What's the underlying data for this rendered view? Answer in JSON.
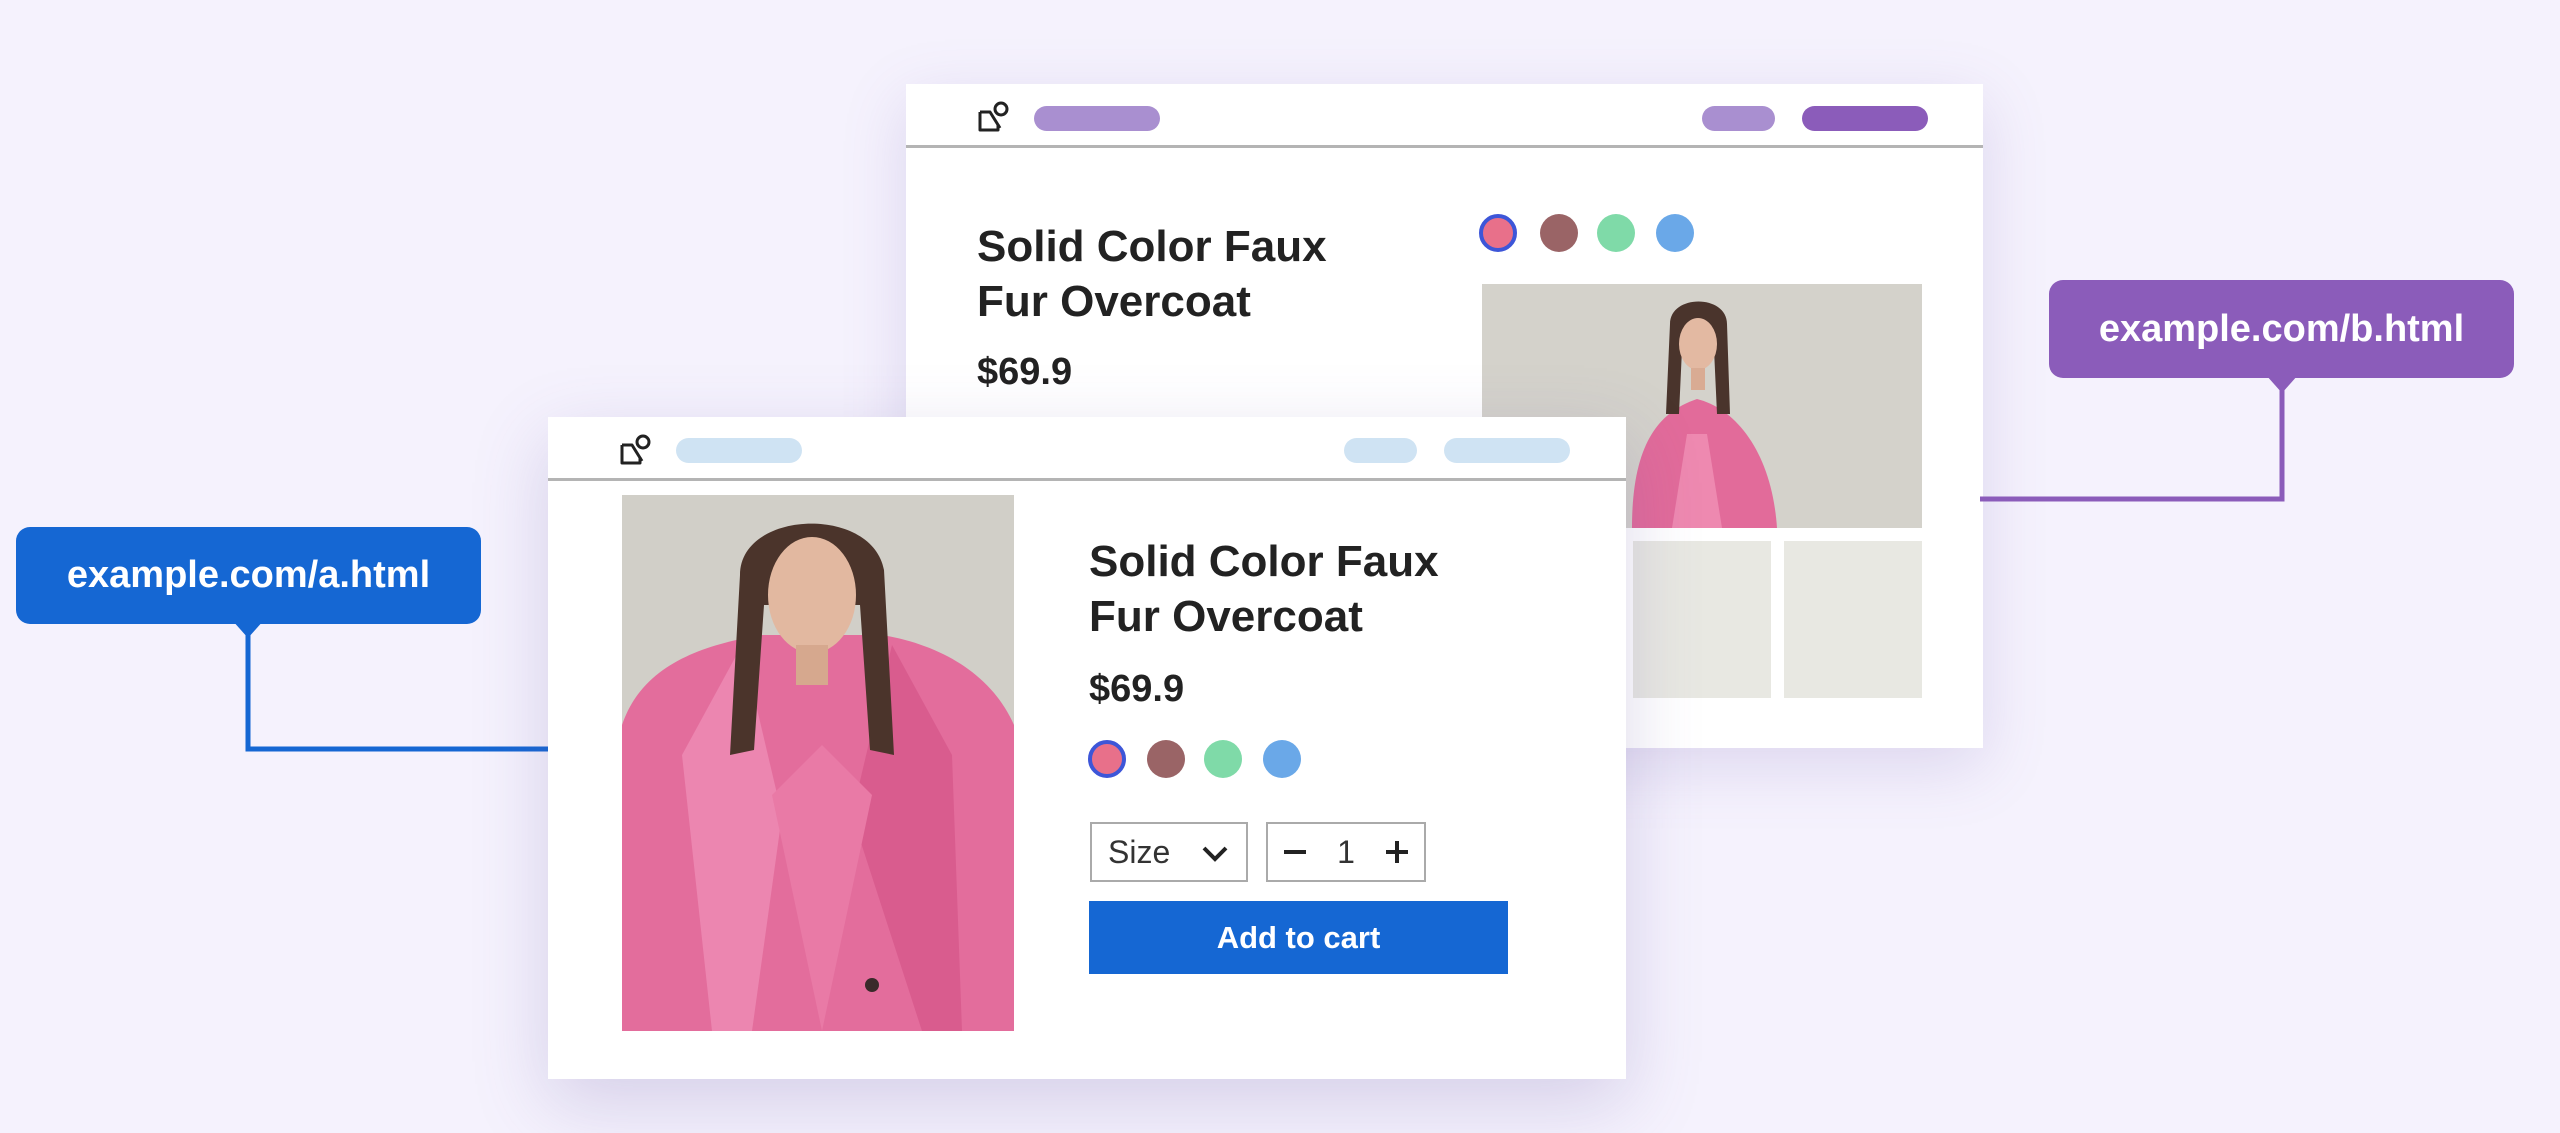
{
  "product_b": {
    "url": "example.com/b.html",
    "title_line1": "Solid Color Faux",
    "title_line2": "Fur Overcoat",
    "price": "$69.9",
    "swatches": [
      "#e8708a",
      "#9a6466",
      "#7fdaa8",
      "#6aa8e8"
    ]
  },
  "product_a": {
    "url": "example.com/a.html",
    "title_line1": "Solid Color Faux",
    "title_line2": "Fur Overcoat",
    "price": "$69.9",
    "swatches": [
      "#e8708a",
      "#9a6466",
      "#7fdaa8",
      "#6aa8e8"
    ],
    "size_label": "Size",
    "quantity": "1",
    "add_to_cart_label": "Add to cart"
  },
  "colors": {
    "variant_a_accent": "#1567d3",
    "variant_b_accent": "#8b5cba",
    "variant_a_nav_placeholder": "#cfe3f3",
    "variant_b_nav_placeholder": "#a98fd0",
    "variant_b_nav_cta": "#8b5cba",
    "selected_swatch_ring": "#3d56d8"
  },
  "icons": {
    "logo": "shape-logo-icon",
    "size_dropdown": "chevron-down-icon",
    "decrement": "minus-icon",
    "increment": "plus-icon"
  }
}
